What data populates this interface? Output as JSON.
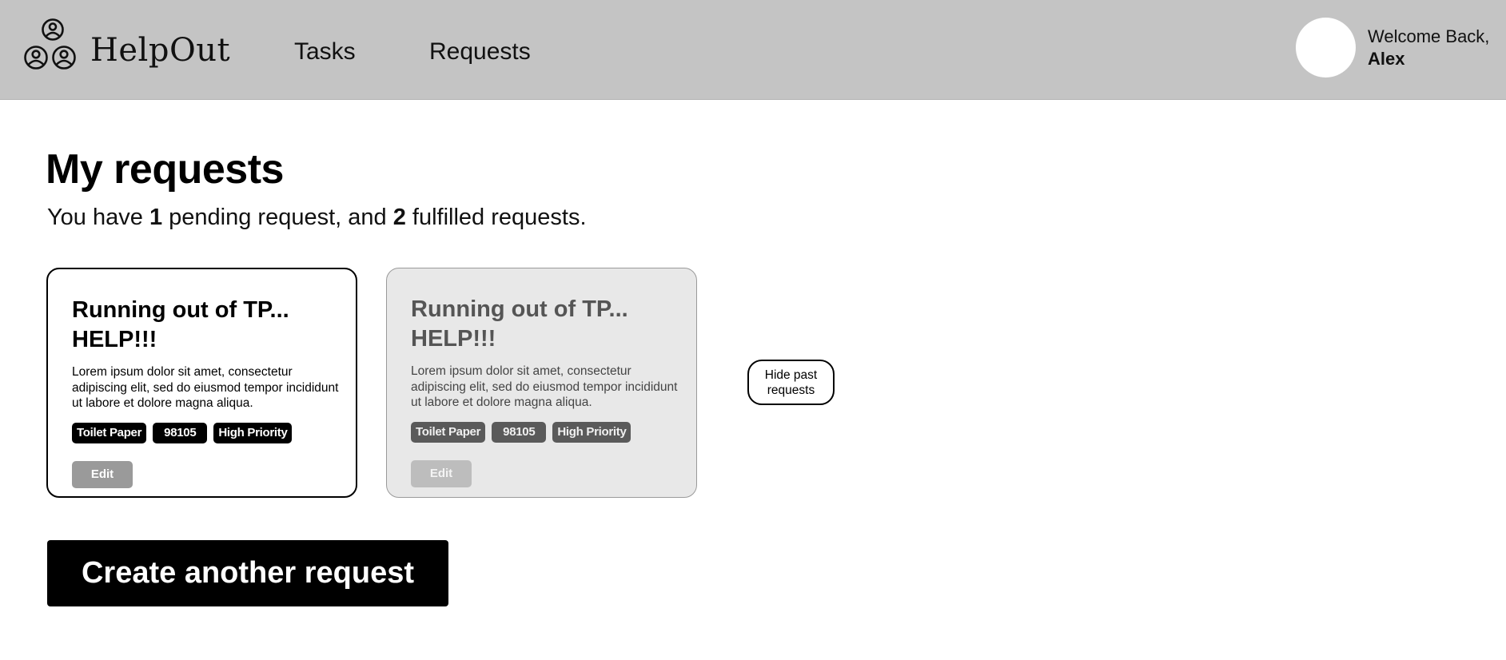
{
  "header": {
    "brand_name": "HelpOut",
    "brand_icon": "people-group-icon",
    "nav": [
      {
        "label": "Tasks"
      },
      {
        "label": "Requests"
      }
    ],
    "welcome_line": "Welcome Back,",
    "user_name": "Alex"
  },
  "main": {
    "title": "My requests",
    "summary": {
      "prefix": "You have ",
      "pending_count": "1",
      "middle": " pending request, and ",
      "fulfilled_count": "2",
      "suffix": " fulfilled requests."
    },
    "cards": [
      {
        "state": "pending",
        "title": "Running out of TP... HELP!!!",
        "description": "Lorem ipsum dolor sit amet, consectetur adipiscing elit, sed do eiusmod tempor incididunt ut labore et dolore magna aliqua.",
        "tags": [
          "Toilet Paper",
          "98105",
          "High Priority"
        ],
        "edit_label": "Edit"
      },
      {
        "state": "fulfilled",
        "title": "Running out of TP... HELP!!!",
        "description": "Lorem ipsum dolor sit amet, consectetur adipiscing elit, sed do eiusmod tempor incididunt ut labore et dolore magna aliqua.",
        "tags": [
          "Toilet Paper",
          "98105",
          "High Priority"
        ],
        "edit_label": "Edit"
      }
    ],
    "hide_past_label": "Hide past requests",
    "create_button_label": "Create another request"
  },
  "colors": {
    "header_bg": "#c4c4c4",
    "past_card_bg": "#e8e8e8",
    "primary_button": "#000000"
  }
}
